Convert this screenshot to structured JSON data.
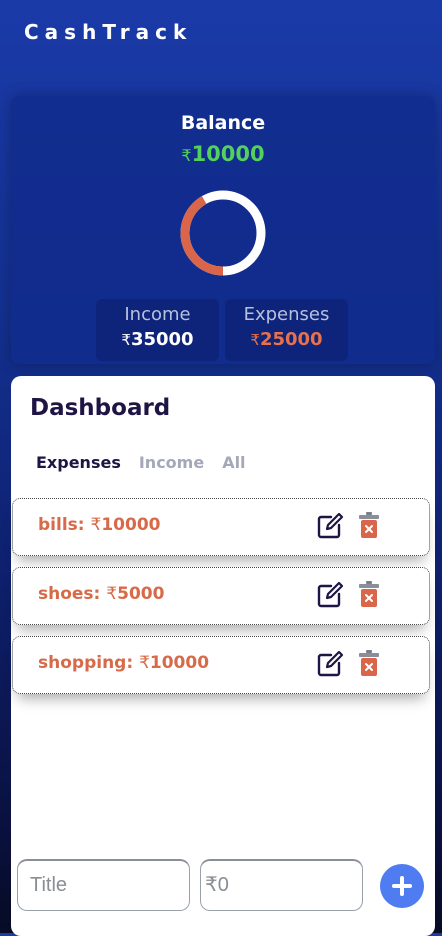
{
  "app": {
    "title": "CashTrack"
  },
  "balance": {
    "label": "Balance",
    "currency": "₹",
    "amount": "10000",
    "expense_fraction": 0.4167,
    "colors": {
      "income_ring": "#ffffff",
      "expense_ring": "#d9654a",
      "balance_text": "#54d15c"
    }
  },
  "stats": {
    "income": {
      "label": "Income",
      "currency": "₹",
      "amount": "35000"
    },
    "expenses": {
      "label": "Expenses",
      "currency": "₹",
      "amount": "25000"
    }
  },
  "dashboard": {
    "title": "Dashboard",
    "tabs": [
      {
        "label": "Expenses",
        "active": true
      },
      {
        "label": "Income",
        "active": false
      },
      {
        "label": "All",
        "active": false
      }
    ],
    "entries": [
      {
        "name": "bills:",
        "currency": "₹",
        "amount": "10000"
      },
      {
        "name": "shoes:",
        "currency": "₹",
        "amount": "5000"
      },
      {
        "name": "shopping:",
        "currency": "₹",
        "amount": "10000"
      }
    ],
    "icons": {
      "edit": "edit-icon",
      "delete": "trash-icon",
      "add": "plus-icon"
    },
    "form": {
      "title_placeholder": "Title",
      "amount_placeholder": "₹0"
    }
  }
}
